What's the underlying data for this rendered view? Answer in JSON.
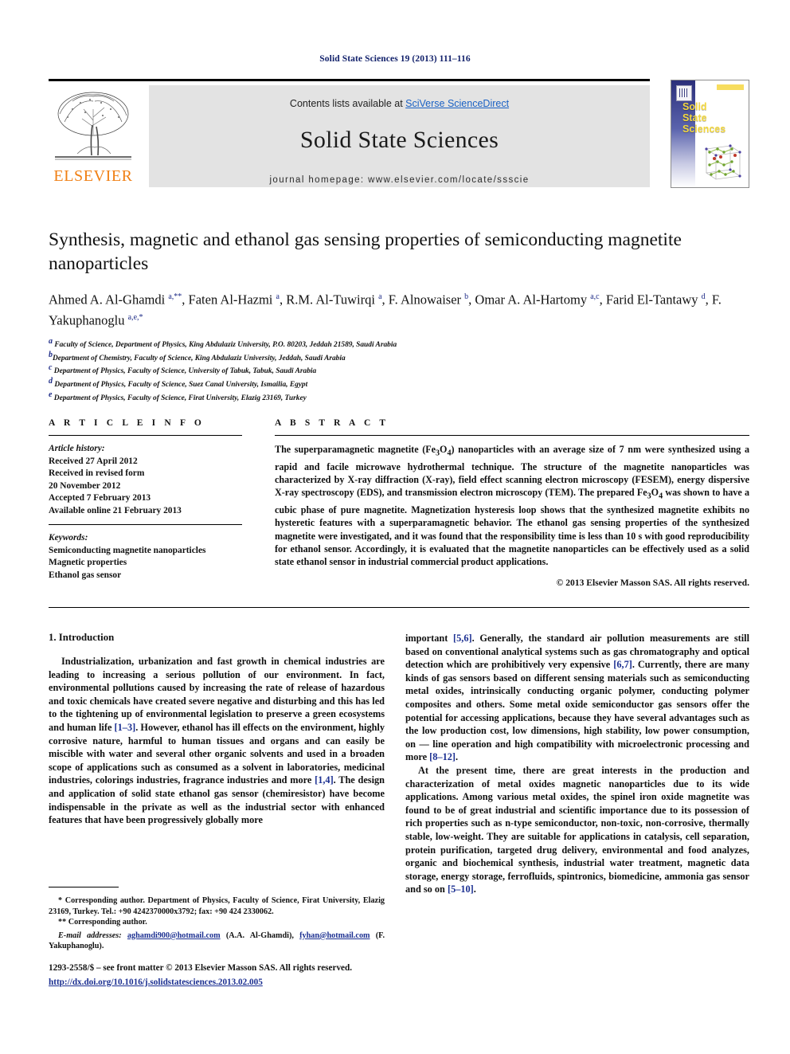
{
  "running_head": "Solid State Sciences 19 (2013) 111–116",
  "header": {
    "contents_prefix": "Contents lists available at ",
    "contents_link": "SciVerse ScienceDirect",
    "journal_title": "Solid State Sciences",
    "homepage": "journal homepage: www.elsevier.com/locate/ssscie",
    "publisher_logo_text": "ELSEVIER",
    "cover_title_lines": [
      "Solid",
      "State",
      "Sciences"
    ],
    "accent_blue": "#1a61c4",
    "elsevier_orange": "#f07f13",
    "cover_yellow": "#f4d83d"
  },
  "article": {
    "title": "Synthesis, magnetic and ethanol gas sensing properties of semiconducting magnetite nanoparticles",
    "authors_line1_parts": [
      {
        "text": "Ahmed A. Al-Ghamdi ",
        "sup": "a,**"
      },
      {
        "text": ", Faten Al-Hazmi ",
        "sup": "a"
      },
      {
        "text": ", R.M. Al-Tuwirqi ",
        "sup": "a"
      },
      {
        "text": ", F. Alnowaiser ",
        "sup": "b"
      },
      {
        "text": ", Omar A. Al-Hartomy ",
        "sup": "a,c"
      }
    ],
    "authors_line2_parts": [
      {
        "text": ", Farid El-Tantawy ",
        "sup": "d"
      },
      {
        "text": ", F. Yakuphanoglu ",
        "sup": "a,e,*"
      }
    ],
    "authors_plain": "Ahmed A. Al-Ghamdi a,**, Faten Al-Hazmi a, R.M. Al-Tuwirqi a, F. Alnowaiser b, Omar A. Al-Hartomy a,c, Farid El-Tantawy d, F. Yakuphanoglu a,e,*",
    "affiliations": [
      {
        "mark": "a",
        "text": "Faculty of Science, Department of Physics, King Abdulaziz University, P.O. 80203, Jeddah 21589, Saudi Arabia"
      },
      {
        "mark": "b",
        "text": "Department of Chemistry, Faculty of Science, King Abdulaziz University, Jeddah, Saudi Arabia"
      },
      {
        "mark": "c",
        "text": "Department of Physics, Faculty of Science, University of Tabuk, Tabuk, Saudi Arabia"
      },
      {
        "mark": "d",
        "text": "Department of Physics, Faculty of Science, Suez Canal University, Ismailia, Egypt"
      },
      {
        "mark": "e",
        "text": "Department of Physics, Faculty of Science, Firat University, Elazig 23169, Turkey"
      }
    ]
  },
  "article_info": {
    "heading": "A R T I C L E   I N F O",
    "history_label": "Article history:",
    "history": [
      "Received 27 April 2012",
      "Received in revised form",
      "20 November 2012",
      "Accepted 7 February 2013",
      "Available online 21 February 2013"
    ],
    "keywords_label": "Keywords:",
    "keywords": [
      "Semiconducting magnetite nanoparticles",
      "Magnetic properties",
      "Ethanol gas sensor"
    ]
  },
  "abstract": {
    "heading": "A B S T R A C T",
    "text": "The superparamagnetic magnetite (Fe3O4) nanoparticles with an average size of 7 nm were synthesized using a rapid and facile microwave hydrothermal technique. The structure of the magnetite nanoparticles was characterized by X-ray diffraction (X-ray), field effect scanning electron microscopy (FESEM), energy dispersive X-ray spectroscopy (EDS), and transmission electron microscopy (TEM). The prepared Fe3O4 was shown to have a cubic phase of pure magnetite. Magnetization hysteresis loop shows that the synthesized magnetite exhibits no hysteretic features with a superparamagnetic behavior. The ethanol gas sensing properties of the synthesized magnetite were investigated, and it was found that the responsibility time is less than 10 s with good reproducibility for ethanol sensor. Accordingly, it is evaluated that the magnetite nanoparticles can be effectively used as a solid state ethanol sensor in industrial commercial product applications.",
    "copyright": "© 2013 Elsevier Masson SAS. All rights reserved."
  },
  "body": {
    "section_title": "1. Introduction",
    "left_paragraphs": [
      "Industrialization, urbanization and fast growth in chemical industries are leading to increasing a serious pollution of our environment. In fact, environmental pollutions caused by increasing the rate of release of hazardous and toxic chemicals have created severe negative and disturbing and this has led to the tightening up of environmental legislation to preserve a green ecosystems and human life [1–3]. However, ethanol has ill effects on the environment, highly corrosive nature, harmful to human tissues and organs and can easily be miscible with water and several other organic solvents and used in a broaden scope of applications such as consumed as a solvent in laboratories, medicinal industries, colorings industries, fragrance industries and more [1,4]. The design and application of solid state ethanol gas sensor (chemiresistor) have become indispensable in the private as well as the industrial sector with enhanced features that have been progressively globally more"
    ],
    "right_paragraphs": [
      "important [5,6]. Generally, the standard air pollution measurements are still based on conventional analytical systems such as gas chromatography and optical detection which are prohibitively very expensive [6,7]. Currently, there are many kinds of gas sensors based on different sensing materials such as semiconducting metal oxides, intrinsically conducting organic polymer, conducting polymer composites and others. Some metal oxide semiconductor gas sensors offer the potential for accessing applications, because they have several advantages such as the low production cost, low dimensions, high stability, low power consumption, on — line operation and high compatibility with microelectronic processing and more [8–12].",
      "At the present time, there are great interests in the production and characterization of metal oxides magnetic nanoparticles due to its wide applications. Among various metal oxides, the spinel iron oxide magnetite was found to be of great industrial and scientific importance due to its possession of rich properties such as n-type semiconductor, non-toxic, non-corrosive, thermally stable, low-weight. They are suitable for applications in catalysis, cell separation, protein purification, targeted drug delivery, environmental and food analyzes, organic and biochemical synthesis, industrial water treatment, magnetic data storage, energy storage, ferrofluids, spintronics, biomedicine, ammonia gas sensor and so on [5–10]."
    ]
  },
  "footnotes": {
    "corresponding_1": "* Corresponding author. Department of Physics, Faculty of Science, Firat University, Elazig 23169, Turkey. Tel.: +90 4242370000x3792; fax: +90 424 2330062.",
    "corresponding_2": "** Corresponding author.",
    "email_label": "E-mail addresses:",
    "email_1": "aghamdi900@hotmail.com",
    "email_1_owner": "(A.A. Al-Ghamdi),",
    "email_2": "fyhan@hotmail.com",
    "email_2_owner": "(F. Yakuphanoglu)."
  },
  "bottom": {
    "issn_line": "1293-2558/$ – see front matter © 2013 Elsevier Masson SAS. All rights reserved.",
    "doi": "http://dx.doi.org/10.1016/j.solidstatesciences.2013.02.005"
  }
}
